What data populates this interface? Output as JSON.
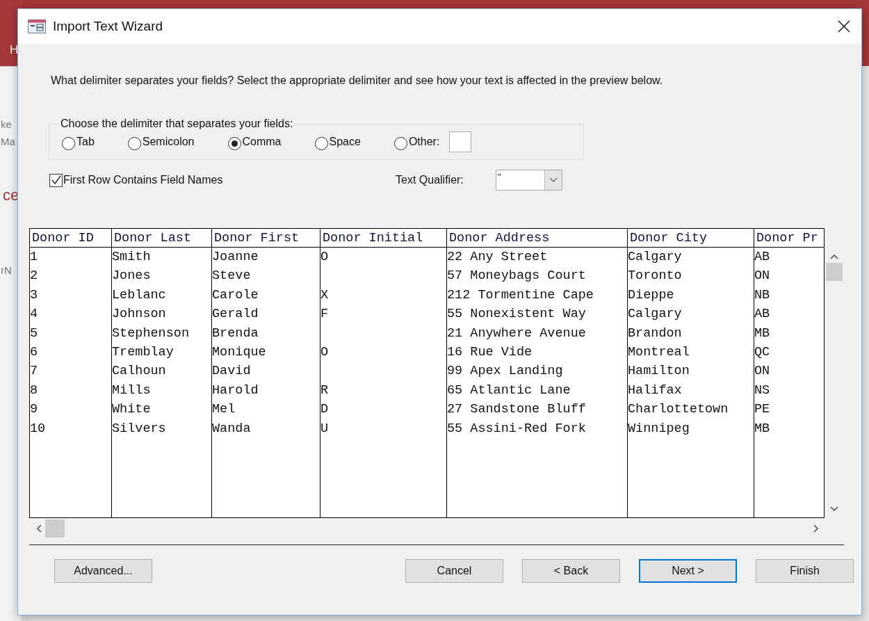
{
  "background": {
    "fragments": [
      "H",
      "ke",
      "Ma",
      "ce",
      "rN"
    ]
  },
  "window": {
    "title": "Import Text Wizard"
  },
  "instruction": "What delimiter separates your fields? Select the appropriate delimiter and see how your text is affected in the preview below.",
  "delimiter_group": {
    "legend": "Choose the delimiter that separates your fields:",
    "options": [
      {
        "label": "Tab",
        "selected": false
      },
      {
        "label": "Semicolon",
        "selected": false
      },
      {
        "label": "Comma",
        "selected": true
      },
      {
        "label": "Space",
        "selected": false
      },
      {
        "label": "Other:",
        "selected": false
      }
    ]
  },
  "first_row_names": {
    "label": "First Row Contains Field Names",
    "checked": true
  },
  "text_qualifier": {
    "label": "Text Qualifier:",
    "value": "\""
  },
  "preview": {
    "columns": [
      "Donor ID",
      "Donor Last",
      "Donor First",
      "Donor Initial",
      "Donor Address",
      "Donor City",
      "Donor Pr"
    ],
    "rows": [
      [
        "1",
        "Smith",
        "Joanne",
        "O",
        "22 Any Street",
        "Calgary",
        "AB"
      ],
      [
        "2",
        "Jones",
        "Steve",
        null,
        "57 Moneybags Court",
        "Toronto",
        "ON"
      ],
      [
        "3",
        "Leblanc",
        "Carole",
        "X",
        "212 Tormentine Cape",
        "Dieppe",
        "NB"
      ],
      [
        "4",
        "Johnson",
        "Gerald",
        "F",
        "55 Nonexistent Way",
        "Calgary",
        "AB"
      ],
      [
        "5",
        "Stephenson",
        "Brenda",
        null,
        "21 Anywhere Avenue",
        "Brandon",
        "MB"
      ],
      [
        "6",
        "Tremblay",
        "Monique",
        "O",
        "16 Rue Vide",
        "Montreal",
        "QC"
      ],
      [
        "7",
        "Calhoun",
        "David",
        null,
        "99 Apex Landing",
        "Hamilton",
        "ON"
      ],
      [
        "8",
        "Mills",
        "Harold",
        "R",
        "65 Atlantic Lane",
        "Halifax",
        "NS"
      ],
      [
        "9",
        "White",
        "Mel",
        "D",
        "27 Sandstone Bluff",
        "Charlottetown",
        "PE"
      ],
      [
        "10",
        "Silvers",
        "Wanda",
        "U",
        "55 Assini-Red Fork",
        "Winnipeg",
        "MB"
      ]
    ]
  },
  "buttons": [
    {
      "label": "Advanced...",
      "kind": "left",
      "default": false
    },
    {
      "label": "Cancel",
      "kind": "right",
      "default": false
    },
    {
      "label": "< Back",
      "kind": "right",
      "default": false
    },
    {
      "label": "Next >",
      "kind": "right",
      "default": true
    },
    {
      "label": "Finish",
      "kind": "right",
      "default": false
    }
  ]
}
